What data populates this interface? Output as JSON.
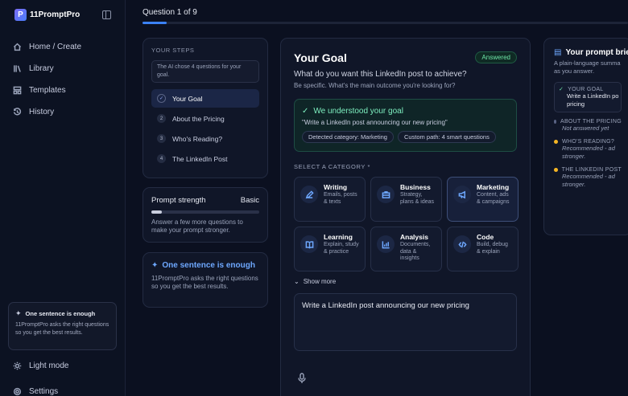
{
  "app": {
    "logo_mark": "P",
    "logo_text": "11PromptPro"
  },
  "sidebar": {
    "items": [
      {
        "label": "Home / Create",
        "icon": "home-icon"
      },
      {
        "label": "Library",
        "icon": "library-icon"
      },
      {
        "label": "Templates",
        "icon": "templates-icon"
      },
      {
        "label": "History",
        "icon": "history-icon"
      }
    ],
    "hint_title": "One sentence is enough",
    "hint_text": "11PromptPro asks the right questions so you get the best results.",
    "light_mode": "Light mode",
    "settings": "Settings"
  },
  "progress": {
    "label": "Question 1 of 9",
    "fraction": 0.05
  },
  "steps": {
    "title": "YOUR STEPS",
    "ai_note": "The AI chose 4 questions for your goal.",
    "items": [
      {
        "num": "✓",
        "label": "Your Goal"
      },
      {
        "num": "2",
        "label": "About the Pricing"
      },
      {
        "num": "3",
        "label": "Who's Reading?"
      },
      {
        "num": "4",
        "label": "The LinkedIn Post"
      }
    ]
  },
  "strength": {
    "title": "Prompt strength",
    "level": "Basic",
    "fraction": 0.1,
    "text": "Answer a few more questions to make your prompt stronger."
  },
  "sentence": {
    "title": "One sentence is enough",
    "text": "11PromptPro asks the right questions so you get the best results."
  },
  "main": {
    "title": "Your Goal",
    "badge": "Answered",
    "question": "What do you want this LinkedIn post to achieve?",
    "subtext": "Be specific. What's the main outcome you're looking for?",
    "understood_title": "We understood your goal",
    "understood_quote": "\"Write a LinkedIn post announcing our new pricing\"",
    "chips": [
      "Detected category: Marketing",
      "Custom path: 4 smart questions"
    ],
    "select_label": "SELECT A CATEGORY *",
    "categories": [
      {
        "name": "Writing",
        "desc": "Emails, posts & texts",
        "icon": "pen-icon"
      },
      {
        "name": "Business",
        "desc": "Strategy, plans & ideas",
        "icon": "briefcase-icon"
      },
      {
        "name": "Marketing",
        "desc": "Content, ads & campaigns",
        "icon": "megaphone-icon"
      },
      {
        "name": "Learning",
        "desc": "Explain, study & practice",
        "icon": "book-icon"
      },
      {
        "name": "Analysis",
        "desc": "Documents, data & insights",
        "icon": "chart-icon"
      },
      {
        "name": "Code",
        "desc": "Build, debug & explain",
        "icon": "code-icon"
      }
    ],
    "show_more": "Show more",
    "input_value": "Write a LinkedIn post announcing our new pricing"
  },
  "brief": {
    "title": "Your prompt brief",
    "sub1": "A plain-language summa",
    "sub2": "as you answer.",
    "items": [
      {
        "label": "YOUR GOAL",
        "value1": "Write a LinkedIn po",
        "value2": "pricing"
      },
      {
        "label": "ABOUT THE PRICING",
        "value1": "Not answered yet",
        "value2": ""
      },
      {
        "label": "WHO'S READING?",
        "value1": "Recommended - ad",
        "value2": "stronger."
      },
      {
        "label": "THE LINKEDIN POST",
        "value1": "Recommended - ad",
        "value2": "stronger."
      }
    ]
  },
  "colors": {
    "accent": "#3b82f6",
    "success": "#6ee7a8",
    "warning": "#f5b524"
  }
}
